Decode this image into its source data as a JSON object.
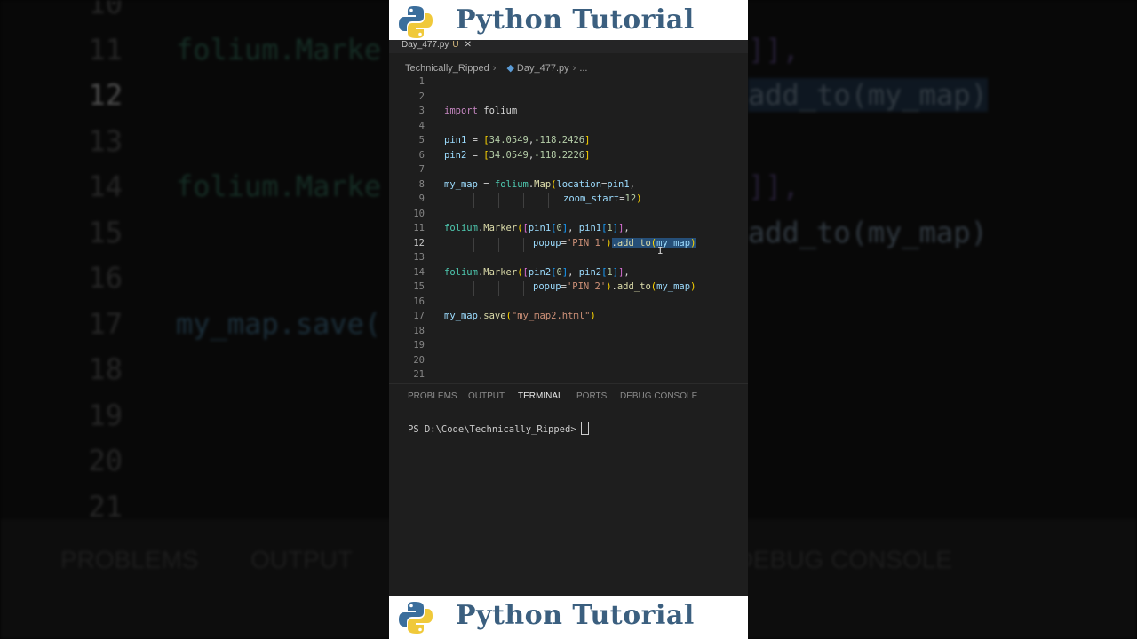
{
  "banner": {
    "title": "Python Tutorial"
  },
  "editor": {
    "active_tab": "Day_477.py",
    "tab_modified": "U",
    "breadcrumb": {
      "folder": "Technically_Ripped",
      "file": "Day_477.py",
      "more": "..."
    },
    "current_line": 12,
    "lines": [
      {
        "n": "1"
      },
      {
        "n": "2"
      },
      {
        "n": "3",
        "t": [
          "import",
          " folium"
        ]
      },
      {
        "n": "4"
      },
      {
        "n": "5",
        "t": [
          "pin1",
          " = ",
          "[",
          "34.0549",
          ",",
          "-118.2426",
          "]"
        ]
      },
      {
        "n": "6",
        "t": [
          "pin2",
          " = ",
          "[",
          "34.0549",
          ",",
          "-118.2226",
          "]"
        ]
      },
      {
        "n": "7"
      },
      {
        "n": "8",
        "t": [
          "my_map",
          " = ",
          "folium",
          ".",
          "Map",
          "(",
          "location",
          "=",
          "pin1",
          ","
        ]
      },
      {
        "n": "9",
        "t": [
          "zoom_start",
          "=",
          "12",
          ")"
        ]
      },
      {
        "n": "10"
      },
      {
        "n": "11",
        "t": [
          "folium",
          ".",
          "Marker",
          "(",
          "[",
          "pin1",
          "[",
          "0",
          "]",
          ", ",
          "pin1",
          "[",
          "1",
          "]",
          "]",
          ","
        ]
      },
      {
        "n": "12",
        "t": [
          "popup",
          "=",
          "'PIN 1'",
          ")",
          ".",
          "add_to",
          "(",
          "my_map",
          ")"
        ]
      },
      {
        "n": "13"
      },
      {
        "n": "14",
        "t": [
          "folium",
          ".",
          "Marker",
          "(",
          "[",
          "pin2",
          "[",
          "0",
          "]",
          ", ",
          "pin2",
          "[",
          "1",
          "]",
          "]",
          ","
        ]
      },
      {
        "n": "15",
        "t": [
          "popup",
          "=",
          "'PIN 2'",
          ")",
          ".",
          "add_to",
          "(",
          "my_map",
          ")"
        ]
      },
      {
        "n": "16"
      },
      {
        "n": "17",
        "t": [
          "my_map",
          ".",
          "save",
          "(",
          "\"my_map2.html\"",
          ")"
        ]
      },
      {
        "n": "18"
      },
      {
        "n": "19"
      },
      {
        "n": "20"
      },
      {
        "n": "21"
      }
    ]
  },
  "panel": {
    "tabs": [
      "PROBLEMS",
      "OUTPUT",
      "TERMINAL",
      "PORTS",
      "DEBUG CONSOLE"
    ],
    "active_tab": "TERMINAL",
    "prompt": "PS D:\\Code\\Technically_Ripped>"
  },
  "background": {
    "line_numbers": [
      "10",
      "11",
      "12",
      "13",
      "14",
      "15",
      "16",
      "17",
      "18",
      "19",
      "20",
      "21"
    ],
    "code_left": {
      "11": "folium.Marke",
      "14": "folium.Marke",
      "17": "my_map.save("
    },
    "code_right": {
      "11": "]],",
      "12": "add_to(my_map)",
      "14": "]],",
      "15": "add_to(my_map)"
    },
    "panel_tabs": [
      "PROBLEMS",
      "OUTPUT",
      "DEBUG CONSOLE"
    ]
  },
  "colors": {
    "editor_bg": "#1e1e1e",
    "banner_text": "#3b5f7f",
    "selection": "#264f78",
    "keyword": "#c586c0",
    "variable": "#9cdcfe"
  }
}
